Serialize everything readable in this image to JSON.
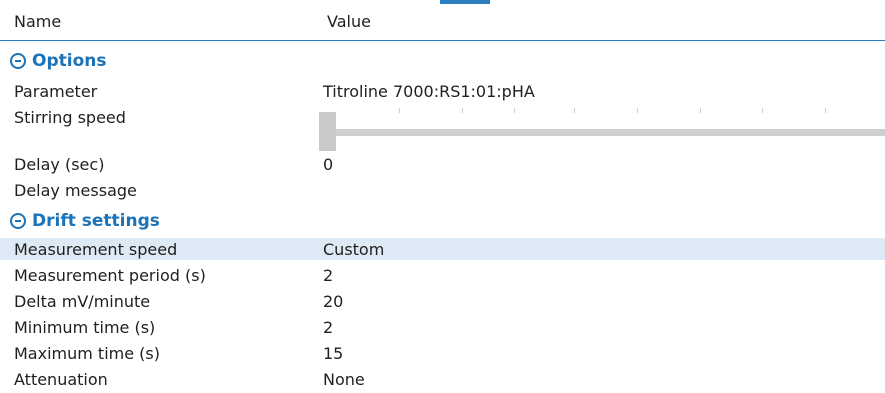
{
  "header": {
    "col_name": "Name",
    "col_value": "Value"
  },
  "sections": {
    "options": {
      "title": "Options",
      "parameter_label": "Parameter",
      "parameter_value": "Titroline 7000:RS1:01:pHA",
      "stirring_label": "Stirring speed",
      "stirring_level_fraction": 0.0,
      "delay_label": "Delay (sec)",
      "delay_value": "0",
      "delay_message_label": "Delay message",
      "delay_message_value": ""
    },
    "drift": {
      "title": "Drift settings",
      "measurement_speed_label": "Measurement speed",
      "measurement_speed_value": "Custom",
      "measurement_period_label": "Measurement period (s)",
      "measurement_period_value": "2",
      "delta_label": "Delta mV/minute",
      "delta_value": "20",
      "min_time_label": "Minimum time (s)",
      "min_time_value": "2",
      "max_time_label": "Maximum time (s)",
      "max_time_value": "15",
      "attenuation_label": "Attenuation",
      "attenuation_value": "None"
    }
  },
  "icons": {
    "collapse": "minus-circle-icon"
  },
  "colors": {
    "accent": "#1c73b8",
    "highlight_row": "#dde9f4",
    "slider": "#cfcfcf"
  }
}
